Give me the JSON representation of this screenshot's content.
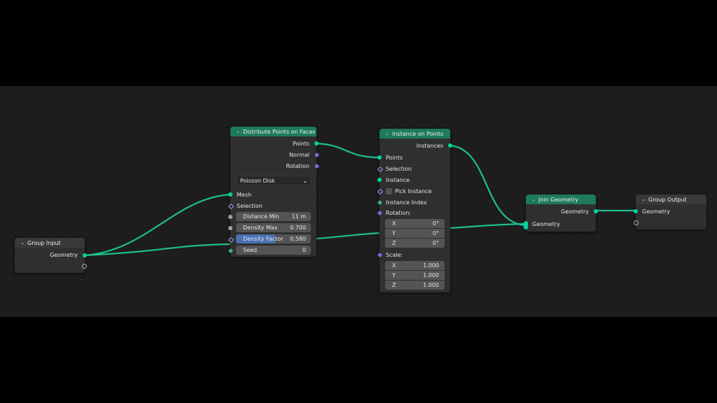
{
  "nodes": {
    "group_input": {
      "title": "Group Input",
      "outputs": [
        "Geometry"
      ]
    },
    "distribute": {
      "title": "Distribute Points on Faces",
      "outputs": [
        "Points",
        "Normal",
        "Rotation"
      ],
      "mode": "Poisson Disk",
      "inputs": [
        "Mesh",
        "Selection"
      ],
      "fields": [
        {
          "label": "Distance Min",
          "value": "11 m"
        },
        {
          "label": "Density Max",
          "value": "0.700"
        },
        {
          "label": "Density Factor",
          "value": "0.580"
        },
        {
          "label": "Seed",
          "value": "0"
        }
      ]
    },
    "instance": {
      "title": "Instance on Points",
      "outputs": [
        "Instances"
      ],
      "inputs": [
        "Points",
        "Selection",
        "Instance",
        "Pick Instance",
        "Instance Index"
      ],
      "rotation_label": "Rotation:",
      "rotation": [
        {
          "axis": "X",
          "value": "0°"
        },
        {
          "axis": "Y",
          "value": "0°"
        },
        {
          "axis": "Z",
          "value": "0°"
        }
      ],
      "scale_label": "Scale:",
      "scale": [
        {
          "axis": "X",
          "value": "1.000"
        },
        {
          "axis": "Y",
          "value": "1.000"
        },
        {
          "axis": "Z",
          "value": "1.000"
        }
      ]
    },
    "join": {
      "title": "Join Geometry",
      "outputs": [
        "Geometry"
      ],
      "inputs": [
        "Geometry"
      ]
    },
    "group_output": {
      "title": "Group Output",
      "inputs": [
        "Geometry"
      ]
    }
  },
  "colors": {
    "geometry_header": "#1e7a5c",
    "io_header": "#393939",
    "wire": "#1fbf8c",
    "geometry_socket": "#00d6a3",
    "vector_socket": "#7a6ae0",
    "float_socket": "#a1a1a1"
  }
}
